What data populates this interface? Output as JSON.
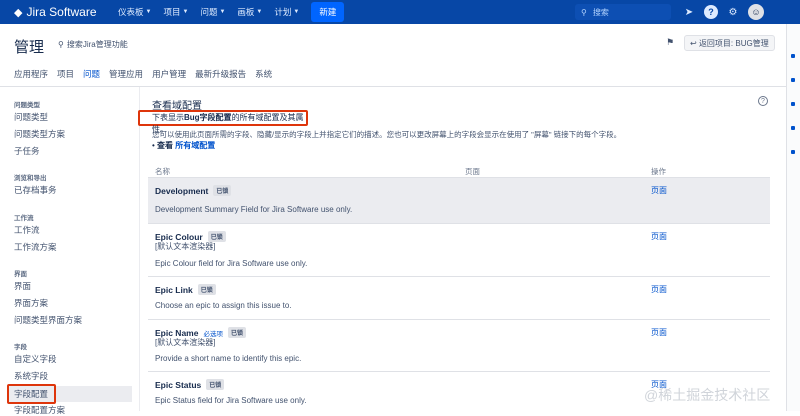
{
  "topbar": {
    "logo_text": "Jira Software",
    "menu": [
      {
        "label": "仪表板"
      },
      {
        "label": "项目"
      },
      {
        "label": "问题"
      },
      {
        "label": "画板"
      },
      {
        "label": "计划"
      }
    ],
    "create_label": "新建",
    "search_placeholder": "搜索"
  },
  "admin": {
    "title": "管理",
    "search_label": "搜索Jira管理功能",
    "return_label": "返回项目: BUG管理",
    "tabs": [
      "应用程序",
      "项目",
      "问题",
      "管理应用",
      "用户管理",
      "最新升级报告",
      "系统"
    ],
    "active_tab": "问题"
  },
  "sidebar": {
    "sections": [
      {
        "title": "问题类型",
        "items": [
          "问题类型",
          "问题类型方案",
          "子任务"
        ]
      },
      {
        "title": "浏览和导出",
        "items": [
          "已存档事务"
        ]
      },
      {
        "title": "工作流",
        "items": [
          "工作流",
          "工作流方案"
        ]
      },
      {
        "title": "界面",
        "items": [
          "界面",
          "界面方案",
          "问题类型界面方案"
        ]
      },
      {
        "title": "字段",
        "items": [
          "自定义字段",
          "系统字段",
          "字段配置",
          "字段配置方案"
        ]
      }
    ],
    "active_item": "字段配置"
  },
  "main": {
    "title": "查看域配置",
    "desc_prefix": "下表显示",
    "desc_bold": "Bug字段配置",
    "desc_suffix": "的所有域配置及其属性。",
    "desc_line": "您可以使用此页面所需的字段、隐藏/显示的字段上并指定它们的描述。您也可以更改屏幕上的字段会显示在使用了 \"屏幕\" 链接下的每个字段。",
    "view_label": "查看",
    "view_link": "所有域配置",
    "columns": {
      "name": "名称",
      "screen": "页面",
      "ops": "操作"
    },
    "rows": [
      {
        "name": "Development",
        "badge": "已锁",
        "renderer": "",
        "desc": "Development Summary Field for Jira Software use only.",
        "op": "页面"
      },
      {
        "name": "Epic Colour",
        "badge": "已锁",
        "renderer": "[默认文本渲染器]",
        "desc": "Epic Colour field for Jira Software use only.",
        "op": "页面"
      },
      {
        "name": "Epic Link",
        "badge": "已锁",
        "renderer": "",
        "desc": "Choose an epic to assign this issue to.",
        "op": "页面"
      },
      {
        "name": "Epic Name",
        "required": "必选项",
        "badge": "已锁",
        "renderer": "[默认文本渲染器]",
        "desc": "Provide a short name to identify this epic.",
        "op": "页面"
      },
      {
        "name": "Epic Status",
        "badge": "已锁",
        "renderer": "",
        "desc": "Epic Status field for Jira Software use only.",
        "op": "页面"
      }
    ]
  },
  "watermark": "@稀土掘金技术社区",
  "colors": {
    "topbar": "#0747a6",
    "link": "#0052cc",
    "highlight_border": "#de350b"
  }
}
